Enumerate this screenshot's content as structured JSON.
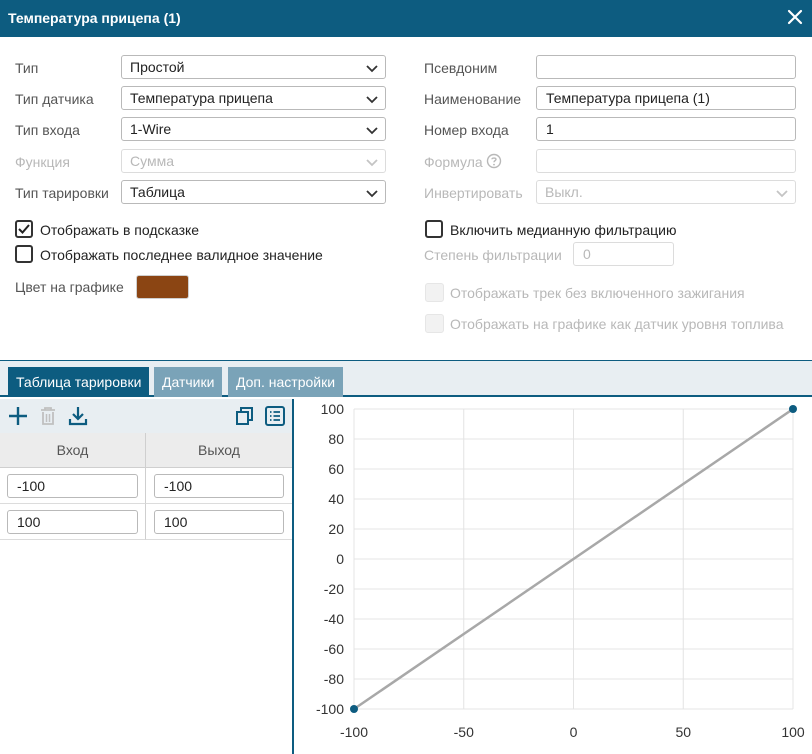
{
  "window": {
    "title": "Температура прицепа (1)",
    "close_icon": "close-icon",
    "title_bg": "#0d5c80"
  },
  "form": {
    "type": {
      "label": "Тип",
      "value": "Простой"
    },
    "sensor_type": {
      "label": "Тип датчика",
      "value": "Температура прицепа"
    },
    "input_type": {
      "label": "Тип входа",
      "value": "1-Wire"
    },
    "function": {
      "label": "Функция",
      "value": "Сумма",
      "disabled": true
    },
    "calibration_type": {
      "label": "Тип тарировки",
      "value": "Таблица"
    },
    "alias": {
      "label": "Псевдоним",
      "value": ""
    },
    "name": {
      "label": "Наименование",
      "value": "Температура прицепа (1)"
    },
    "input_number": {
      "label": "Номер входа",
      "value": "1"
    },
    "formula": {
      "label": "Формула",
      "value": "",
      "disabled": true,
      "help_icon": "help-icon"
    },
    "invert": {
      "label": "Инвертировать",
      "value": "Выкл.",
      "disabled": true
    },
    "show_in_tooltip": {
      "label": "Отображать в подсказке",
      "checked": true
    },
    "show_last_valid": {
      "label": "Отображать последнее валидное значение",
      "checked": false
    },
    "median_filter": {
      "label": "Включить медианную фильтрацию",
      "checked": false
    },
    "filter_degree": {
      "label": "Степень фильтрации",
      "value": "0",
      "disabled": true
    },
    "track_without_ignition": {
      "label": "Отображать трек без включенного зажигания",
      "checked": false,
      "disabled": true
    },
    "show_as_fuel": {
      "label": "Отображать на графике как датчик уровня топлива",
      "checked": false,
      "disabled": true
    },
    "graph_color": {
      "label": "Цвет на графике",
      "color": "#8b4513"
    }
  },
  "tabs": [
    {
      "label": "Таблица тарировки",
      "active": true
    },
    {
      "label": "Датчики",
      "active": false
    },
    {
      "label": "Доп. настройки",
      "active": false
    }
  ],
  "toolbar": {
    "add_icon": "plus-icon",
    "delete_icon": "trash-icon",
    "download_icon": "download-icon",
    "copy_icon": "copy-icon",
    "list_icon": "list-icon"
  },
  "table": {
    "columns": [
      "Вход",
      "Выход"
    ],
    "rows": [
      {
        "input": "-100",
        "output": "-100"
      },
      {
        "input": "100",
        "output": "100"
      }
    ]
  },
  "chart_data": {
    "type": "line",
    "x": [
      -100,
      100
    ],
    "y": [
      -100,
      100
    ],
    "xlim": [
      -100,
      100
    ],
    "ylim": [
      -100,
      100
    ],
    "xticks": [
      -100,
      -50,
      0,
      50,
      100
    ],
    "yticks": [
      -100,
      -80,
      -60,
      -40,
      -20,
      0,
      20,
      40,
      60,
      80,
      100
    ],
    "grid": true,
    "line_color": "#a8a8a8",
    "marker_color": "#0d5c80"
  }
}
